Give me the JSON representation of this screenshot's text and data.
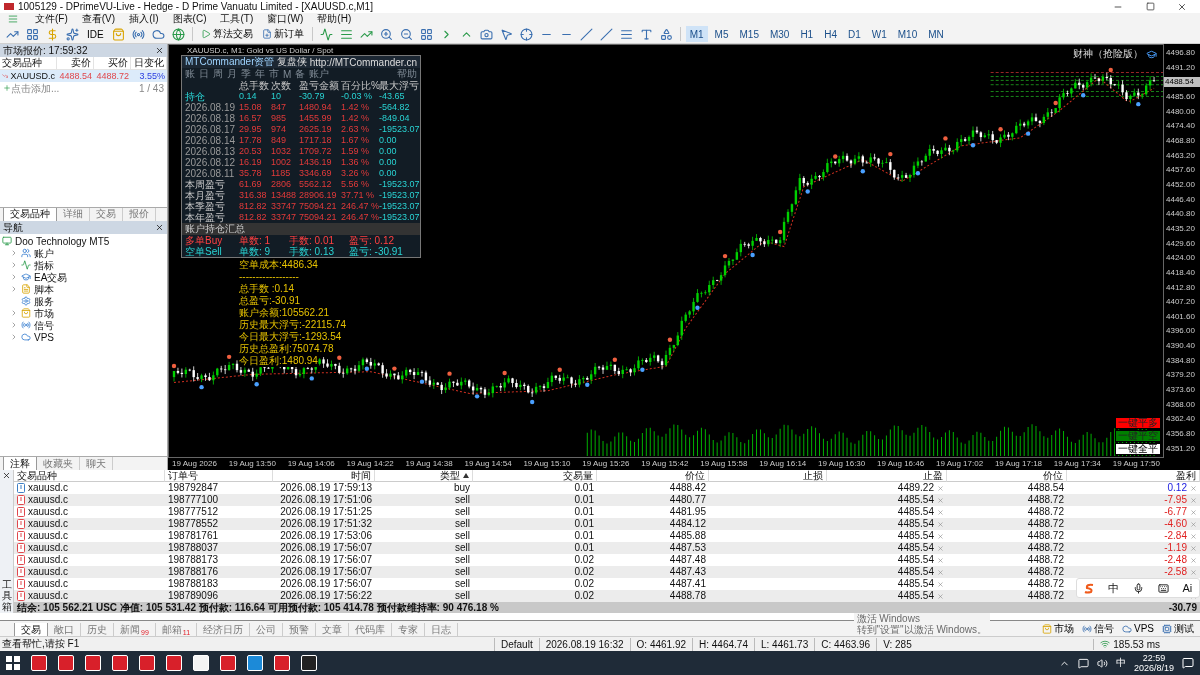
{
  "window": {
    "title": "1005129 - DPrimeVU-Live - Hedge - D Prime Vanuatu Limited - [XAUUSD.c,M1]"
  },
  "menu": [
    "文件(F)",
    "查看(V)",
    "插入(I)",
    "图表(C)",
    "工具(T)",
    "窗口(W)",
    "帮助(H)"
  ],
  "toolbar": {
    "ide": "IDE",
    "algo_trading": "算法交易",
    "new_order": "新订单",
    "timeframes": [
      {
        "label": "M1",
        "selected": true
      },
      {
        "label": "M5",
        "selected": false
      },
      {
        "label": "M15",
        "selected": false
      },
      {
        "label": "M30",
        "selected": false
      },
      {
        "label": "H1",
        "selected": false
      },
      {
        "label": "H4",
        "selected": false
      },
      {
        "label": "D1",
        "selected": false
      },
      {
        "label": "W1",
        "selected": false
      },
      {
        "label": "M10",
        "selected": false
      },
      {
        "label": "MN",
        "selected": false
      }
    ]
  },
  "market_watch": {
    "title": "市场报价: 17:59:32",
    "columns": [
      "交易品种",
      "卖价",
      "买价",
      "日变化"
    ],
    "rows": [
      {
        "symbol": "XAUUSD.c",
        "bid": "4488.54",
        "ask": "4488.72",
        "change": "3.55%",
        "selected": true
      }
    ],
    "add_hint": "点击添加...",
    "count": "1 / 43",
    "tabs": [
      {
        "label": "交易品种",
        "selected": true
      },
      {
        "label": "详细",
        "selected": false
      },
      {
        "label": "交易",
        "selected": false
      },
      {
        "label": "报价",
        "selected": false
      }
    ]
  },
  "navigator": {
    "title": "导航",
    "root": {
      "label": "Doo Technology MT5",
      "children": [
        {
          "label": "账户",
          "kind": "accounts"
        },
        {
          "label": "指标",
          "kind": "indicators"
        },
        {
          "label": "EA交易",
          "kind": "experts"
        },
        {
          "label": "脚本",
          "kind": "scripts"
        },
        {
          "label": "服务",
          "kind": "services"
        },
        {
          "label": "市场",
          "kind": "market"
        },
        {
          "label": "信号",
          "kind": "signals"
        },
        {
          "label": "VPS",
          "kind": "vps"
        }
      ]
    },
    "tabs": [
      {
        "label": "注释",
        "selected": true
      },
      {
        "label": "收藏夹",
        "selected": false
      },
      {
        "label": "聊天",
        "selected": false
      }
    ]
  },
  "chart": {
    "title": "XAUUSD.c, M1:  Gold vs US Dollar / Spot",
    "expert": "财神（抢险版）",
    "price_labels": [
      "4496.80",
      "4491.20",
      "4485.60",
      "4480.00",
      "4474.40",
      "4468.80",
      "4463.20",
      "4457.60",
      "4452.00",
      "4446.40",
      "4440.80",
      "4435.20",
      "4429.60",
      "4424.00",
      "4418.40",
      "4412.80",
      "4407.20",
      "4401.60",
      "4396.00",
      "4390.40",
      "4384.80",
      "4379.20",
      "4373.60",
      "4368.00",
      "4362.40",
      "4356.80",
      "4351.20"
    ],
    "current_price": "4488.54",
    "time_labels": [
      "19 Aug 2026",
      "19 Aug 13:50",
      "19 Aug 14:06",
      "19 Aug 14:22",
      "19 Aug 14:38",
      "19 Aug 14:54",
      "19 Aug 15:10",
      "19 Aug 15:26",
      "19 Aug 15:42",
      "19 Aug 15:58",
      "19 Aug 16:14",
      "19 Aug 16:30",
      "19 Aug 16:46",
      "19 Aug 17:02",
      "19 Aug 17:18",
      "19 Aug 17:34",
      "19 Aug 17:50"
    ],
    "buttons": [
      {
        "label": "一键平多",
        "color": "#ff0000"
      },
      {
        "label": "一键平空",
        "color": "#008000"
      },
      {
        "label": "一键全平",
        "color": "#ffffff"
      }
    ],
    "commander": {
      "title": "MTCommander资管",
      "subtitle": "复盘侠",
      "link": "http://MTCommander.cn",
      "tabs": [
        "账",
        "日",
        "周",
        "月",
        "季",
        "年",
        "市",
        "M",
        "备",
        "账户"
      ],
      "help": "帮助",
      "columns": [
        "总手数",
        "次数",
        "盈亏金额",
        "百分比%",
        "最大浮亏"
      ],
      "rows": [
        {
          "kind": "position",
          "label": "持仓",
          "values": [
            "0.14",
            "10",
            "-30.79",
            "-0.03 %",
            "-43.65"
          ]
        },
        {
          "kind": "day",
          "label": "2026.08.19",
          "values": [
            "15.08",
            "847",
            "1480.94",
            "1.42 %",
            "-564.82"
          ]
        },
        {
          "kind": "day",
          "label": "2026.08.18",
          "values": [
            "16.57",
            "985",
            "1455.99",
            "1.42 %",
            "-849.04"
          ]
        },
        {
          "kind": "day",
          "label": "2026.08.17",
          "values": [
            "29.95",
            "974",
            "2625.19",
            "2.63 %",
            "-19523.07"
          ]
        },
        {
          "kind": "day",
          "label": "2026.08.14",
          "values": [
            "17.78",
            "849",
            "1717.18",
            "1.67 %",
            "0.00"
          ]
        },
        {
          "kind": "day",
          "label": "2026.08.13",
          "values": [
            "20.53",
            "1032",
            "1709.72",
            "1.59 %",
            "0.00"
          ]
        },
        {
          "kind": "day",
          "label": "2026.08.12",
          "values": [
            "16.19",
            "1002",
            "1436.19",
            "1.36 %",
            "0.00"
          ]
        },
        {
          "kind": "day",
          "label": "2026.08.11",
          "values": [
            "35.78",
            "1185",
            "3346.69",
            "3.26 %",
            "0.00"
          ]
        },
        {
          "kind": "period",
          "label": "本周盈亏",
          "values": [
            "61.69",
            "2806",
            "5562.12",
            "5.56 %",
            "-19523.07"
          ]
        },
        {
          "kind": "period",
          "label": "本月盈亏",
          "values": [
            "316.38",
            "13488",
            "28906.19",
            "37.71 %",
            "-19523.07"
          ]
        },
        {
          "kind": "period",
          "label": "本季盈亏",
          "values": [
            "812.82",
            "33747",
            "75094.21",
            "246.47 %",
            "-19523.07"
          ]
        },
        {
          "kind": "period",
          "label": "本年盈亏",
          "values": [
            "812.82",
            "33747",
            "75094.21",
            "246.47 %",
            "-19523.07"
          ]
        }
      ],
      "summary_title": "账户持仓汇总",
      "sides": [
        {
          "kind": "buy",
          "label": "多单Buy",
          "count": "单数: 1",
          "lots": "手数: 0.01",
          "pnl": "盈亏: 0.12"
        },
        {
          "kind": "sell",
          "label": "空单Sell",
          "count": "单数: 9",
          "lots": "手数: 0.13",
          "pnl": "盈亏: -30.91"
        }
      ]
    },
    "info_lines": [
      "空单成本:4486.34",
      "------------------",
      "总手数 :0.14",
      "总盈亏:-30.91",
      "账户余额:105562.21",
      "历史最大浮亏:-22115.74",
      "今日最大浮亏:-1293.54",
      "历史总盈利:75074.78",
      "今日盈利:1480.94"
    ]
  },
  "toolbox": {
    "label": "工具箱",
    "columns": [
      "交易品种",
      "订单号",
      "时间",
      "类型",
      "交易量",
      "价位",
      "止损",
      "止盈",
      "价位",
      "盈利"
    ],
    "rows": [
      {
        "symbol": "xauusd.c",
        "order": "198792847",
        "time": "2026.08.19 17:59:13",
        "type": "buy",
        "volume": "0.01",
        "price": "4488.42",
        "tp": "4489.22",
        "current": "4488.54",
        "profit": "0.12",
        "loss": false,
        "color": "#3d7fc4"
      },
      {
        "symbol": "xauusd.c",
        "order": "198777100",
        "time": "2026.08.19 17:51:06",
        "type": "sell",
        "volume": "0.01",
        "price": "4480.77",
        "tp": "4485.54",
        "current": "4488.72",
        "profit": "-7.95",
        "loss": true,
        "color": "#e0474c"
      },
      {
        "symbol": "xauusd.c",
        "order": "198777512",
        "time": "2026.08.19 17:51:25",
        "type": "sell",
        "volume": "0.01",
        "price": "4481.95",
        "tp": "4485.54",
        "current": "4488.72",
        "profit": "-6.77",
        "loss": true,
        "color": "#e0474c"
      },
      {
        "symbol": "xauusd.c",
        "order": "198778552",
        "time": "2026.08.19 17:51:32",
        "type": "sell",
        "volume": "0.01",
        "price": "4484.12",
        "tp": "4485.54",
        "current": "4488.72",
        "profit": "-4.60",
        "loss": true,
        "color": "#e0474c"
      },
      {
        "symbol": "xauusd.c",
        "order": "198781761",
        "time": "2026.08.19 17:53:06",
        "type": "sell",
        "volume": "0.01",
        "price": "4485.88",
        "tp": "4485.54",
        "current": "4488.72",
        "profit": "-2.84",
        "loss": true,
        "color": "#e0474c"
      },
      {
        "symbol": "xauusd.c",
        "order": "198788037",
        "time": "2026.08.19 17:56:07",
        "type": "sell",
        "volume": "0.01",
        "price": "4487.53",
        "tp": "4485.54",
        "current": "4488.72",
        "profit": "-1.19",
        "loss": true,
        "color": "#e0474c"
      },
      {
        "symbol": "xauusd.c",
        "order": "198788173",
        "time": "2026.08.19 17:56:07",
        "type": "sell",
        "volume": "0.02",
        "price": "4487.48",
        "tp": "4485.54",
        "current": "4488.72",
        "profit": "-2.48",
        "loss": true,
        "color": "#e0474c"
      },
      {
        "symbol": "xauusd.c",
        "order": "198788176",
        "time": "2026.08.19 17:56:07",
        "type": "sell",
        "volume": "0.02",
        "price": "4487.43",
        "tp": "4485.54",
        "current": "4488.72",
        "profit": "-2.58",
        "loss": true,
        "color": "#e0474c"
      },
      {
        "symbol": "xauusd.c",
        "order": "198788183",
        "time": "2026.08.19 17:56:07",
        "type": "sell",
        "volume": "0.02",
        "price": "4487.41",
        "tp": "4485.54",
        "current": "4488.72",
        "color": "#e0474c"
      },
      {
        "symbol": "xauusd.c",
        "order": "198789096",
        "time": "2026.08.19 17:56:22",
        "type": "sell",
        "volume": "0.02",
        "price": "4488.78",
        "tp": "4485.54",
        "current": "4488.72",
        "color": "#e0474c"
      }
    ],
    "summary": "结余: 105 562.21 USC  净值: 105 531.42  预付款: 116.64  可用预付款: 105 414.78  预付款维持率: 90 476.18 %",
    "total": "-30.79",
    "tabs": [
      {
        "label": "交易",
        "selected": true
      },
      {
        "label": "敞口",
        "selected": false
      },
      {
        "label": "历史",
        "selected": false
      },
      {
        "label": "新闻",
        "badge": "99",
        "selected": false
      },
      {
        "label": "邮箱",
        "badge": "11",
        "selected": false
      },
      {
        "label": "经济日历",
        "selected": false
      },
      {
        "label": "公司",
        "selected": false
      },
      {
        "label": "预警",
        "selected": false
      },
      {
        "label": "文章",
        "selected": false
      },
      {
        "label": "代码库",
        "selected": false
      },
      {
        "label": "专家",
        "selected": false
      },
      {
        "label": "日志",
        "selected": false
      }
    ],
    "services": [
      {
        "label": "市场",
        "kind": "market"
      },
      {
        "label": "信号",
        "kind": "signals"
      },
      {
        "label": "VPS",
        "kind": "vps"
      },
      {
        "label": "测试",
        "kind": "tester"
      }
    ]
  },
  "ime_bar": {
    "mode": "中",
    "assistant": "Ai"
  },
  "activation": {
    "title": "激活 Windows",
    "subtitle": "转到\"设置\"以激活 Windows。"
  },
  "status_bar": {
    "help": "查看帮忙,请按 F1",
    "fields": [
      "Default",
      "2026.08.19 16:32",
      "O: 4461.92",
      "H: 4464.74",
      "L: 4461.73",
      "C: 4463.96",
      "V: 285"
    ],
    "ping": "185.53 ms"
  },
  "taskbar": {
    "apps": [
      {
        "kind": "terminal"
      },
      {
        "kind": "terminal"
      },
      {
        "kind": "terminal"
      },
      {
        "kind": "terminal"
      },
      {
        "kind": "terminal"
      },
      {
        "kind": "terminal"
      },
      {
        "kind": "cpt"
      },
      {
        "kind": "terminal"
      },
      {
        "kind": "browser"
      },
      {
        "kind": "terminal"
      },
      {
        "kind": "penguin"
      }
    ],
    "ime": "中",
    "time": "22:59",
    "date": "2026/8/19"
  }
}
